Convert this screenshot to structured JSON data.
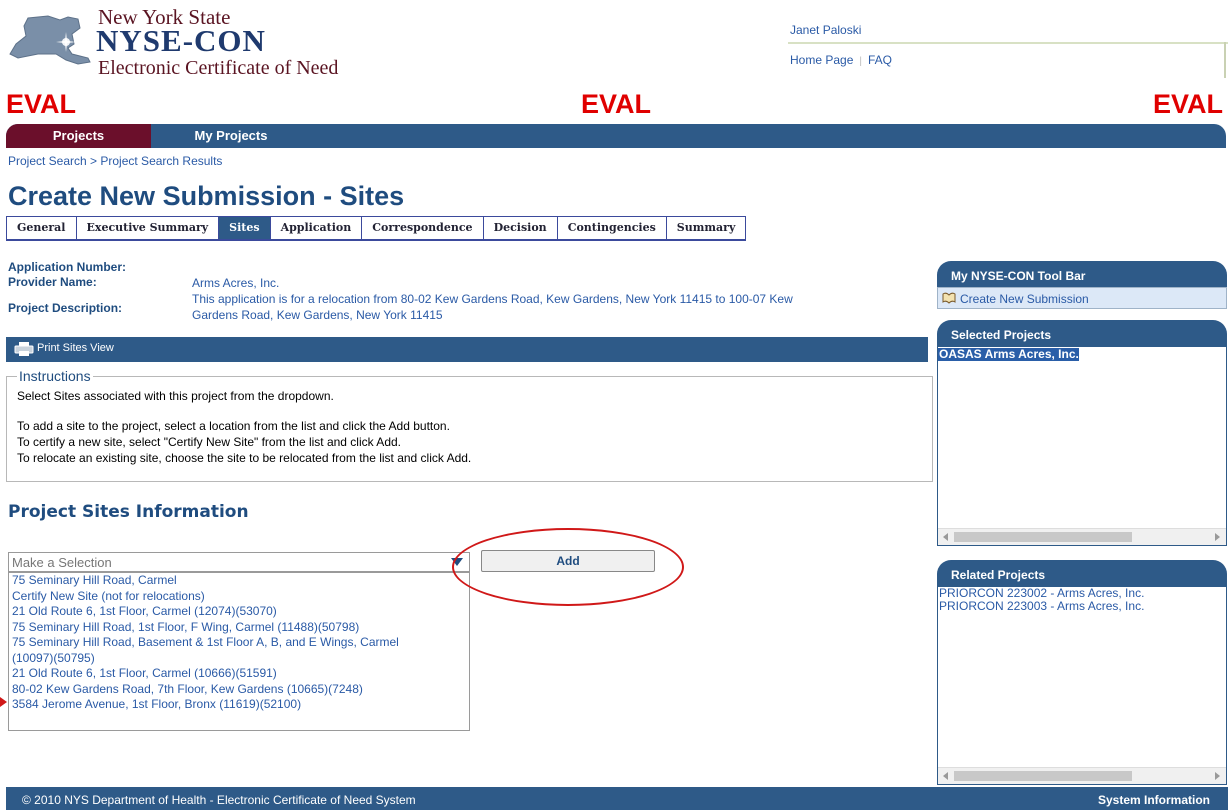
{
  "header": {
    "logo_line1": "New York State",
    "logo_line2": "NYSE-CON",
    "logo_line3": "Electronic Certificate of Need",
    "user_name": "Janet Paloski",
    "links": {
      "home": "Home Page",
      "sep": "|",
      "faq": "FAQ"
    },
    "eval_labels": [
      "EVAL",
      "EVAL",
      "EVAL"
    ]
  },
  "nav": {
    "projects": "Projects",
    "my_projects": "My Projects"
  },
  "breadcrumb": "Project Search > Project Search Results",
  "page_title": "Create New Submission - Sites",
  "tabs": [
    "General",
    "Executive Summary",
    "Sites",
    "Application",
    "Correspondence",
    "Decision",
    "Contingencies",
    "Summary"
  ],
  "active_tab": "Sites",
  "application": {
    "number_label": "Application Number:",
    "provider_label": "Provider Name:",
    "provider_value": "Arms Acres, Inc.",
    "description_label": "Project Description:",
    "description_line1": "This application is for a relocation from 80-02 Kew Gardens Road, Kew Gardens, New York 11415 to 100-07 Kew",
    "description_line2": "Gardens Road, Kew Gardens, New York 11415"
  },
  "print_bar": {
    "label": "Print Sites View"
  },
  "instructions": {
    "legend": "Instructions",
    "line1": "Select Sites associated with this project from the dropdown.",
    "line2": "To add a site to the project, select a location from the list and click the Add button.",
    "line3": "To certify a new site, select \"Certify New Site\" from the list and click Add.",
    "line4": "To relocate an existing site, choose the site to be relocated from the list and click Add."
  },
  "sites_section": {
    "title": "Project Sites Information",
    "select_placeholder": "Make a Selection",
    "add_button": "Add",
    "options": [
      "75 Seminary Hill Road, Carmel",
      "Certify New Site (not for relocations)",
      "21 Old Route 6, 1st Floor, Carmel (12074)(53070)",
      "75 Seminary Hill Road, 1st Floor, F Wing, Carmel (11488)(50798)",
      "75 Seminary Hill Road, Basement & 1st Floor A, B, and E Wings, Carmel",
      "(10097)(50795)",
      "21 Old Route 6, 1st Floor, Carmel (10666)(51591)",
      "80-02 Kew Gardens Road, 7th Floor, Kew Gardens (10665)(7248)",
      "3584 Jerome Avenue, 1st Floor, Bronx (11619)(52100)"
    ]
  },
  "toolbar": {
    "title": "My NYSE-CON Tool Bar",
    "create_link": "Create New Submission"
  },
  "selected_projects": {
    "title": "Selected Projects",
    "items": [
      "OASAS Arms Acres, Inc."
    ]
  },
  "related_projects": {
    "title": "Related Projects",
    "items": [
      "PRIORCON 223002 - Arms Acres, Inc.",
      "PRIORCON 223003 - Arms Acres, Inc."
    ]
  },
  "footer": {
    "copyright": "© 2010 NYS Department of Health - Electronic Certificate of Need System",
    "system_info": "System Information"
  },
  "colors": {
    "nav_blue": "#2e5a88",
    "nav_active": "#6b0f2b",
    "eval_red": "#e00000",
    "link_blue": "#2a5aa6"
  }
}
